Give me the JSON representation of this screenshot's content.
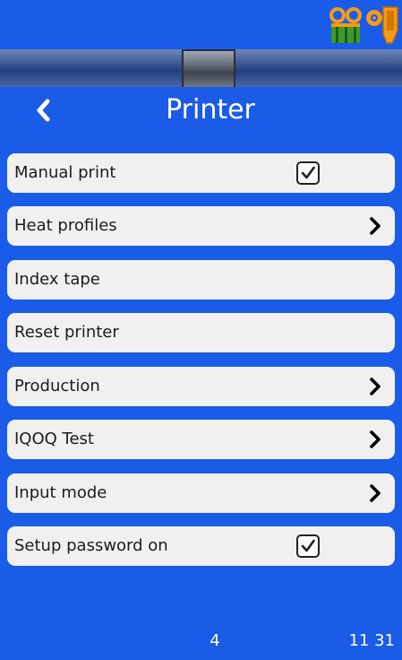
{
  "header": {
    "title": "Printer",
    "back_icon": "chevron-left-icon",
    "status_icons": [
      "tape-cassette-icon",
      "printer-head-icon"
    ]
  },
  "menu": {
    "items": [
      {
        "label": "Manual print",
        "control": "checkbox",
        "checked": true
      },
      {
        "label": "Heat profiles",
        "control": "chevron"
      },
      {
        "label": "Index tape",
        "control": "none"
      },
      {
        "label": "Reset printer",
        "control": "none"
      },
      {
        "label": "Production",
        "control": "chevron"
      },
      {
        "label": "IQOQ Test",
        "control": "chevron"
      },
      {
        "label": "Input mode",
        "control": "chevron"
      },
      {
        "label": "Setup password on",
        "control": "checkbox",
        "checked": true
      }
    ]
  },
  "footer": {
    "left_value": "4",
    "time": "11 31"
  },
  "colors": {
    "background": "#1a5ce8",
    "row": "#f0f0f0",
    "accent_orange": "#f29a1a",
    "accent_green": "#3c9a2e"
  }
}
